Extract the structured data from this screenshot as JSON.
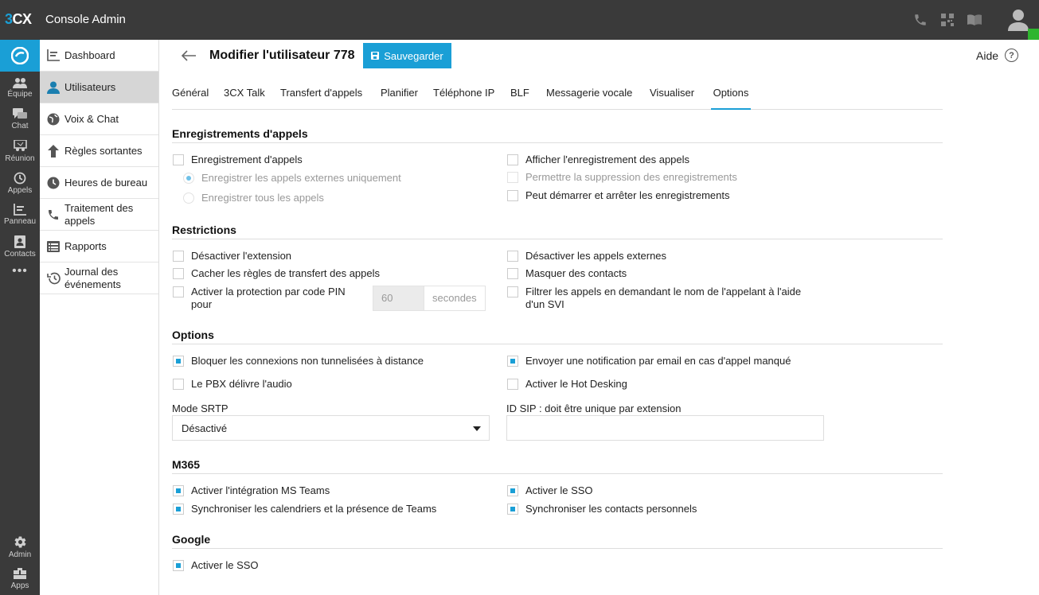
{
  "topbar": {
    "logo_prefix": "3",
    "logo_suffix": "CX",
    "title": "Console Admin",
    "icons": [
      "phone-icon",
      "qr-code-icon",
      "book-icon",
      "user-avatar-icon"
    ],
    "status_color": "#2fb52f"
  },
  "rail": {
    "items": [
      {
        "label": "Équipe",
        "icon": "team-icon"
      },
      {
        "label": "Chat",
        "icon": "chat-icon"
      },
      {
        "label": "Réunion",
        "icon": "meeting-icon"
      },
      {
        "label": "Appels",
        "icon": "call-history-icon"
      },
      {
        "label": "Panneau",
        "icon": "panel-icon"
      },
      {
        "label": "Contacts",
        "icon": "contacts-icon"
      }
    ],
    "more": "•••",
    "bottom": [
      {
        "label": "Admin",
        "icon": "gear-icon"
      },
      {
        "label": "Apps",
        "icon": "apps-icon"
      }
    ]
  },
  "subnav": {
    "items": [
      {
        "label": "Dashboard",
        "icon": "dashboard-icon"
      },
      {
        "label": "Utilisateurs",
        "icon": "user-icon",
        "active": true
      },
      {
        "label": "Voix & Chat",
        "icon": "globe-icon"
      },
      {
        "label": "Règles sortantes",
        "icon": "arrow-up-icon"
      },
      {
        "label": "Heures de bureau",
        "icon": "clock-icon"
      },
      {
        "label": "Traitement des appels",
        "icon": "phone-icon"
      },
      {
        "label": "Rapports",
        "icon": "list-icon"
      },
      {
        "label": "Journal des événements",
        "icon": "history-icon"
      }
    ]
  },
  "header": {
    "title": "Modifier l'utilisateur 778",
    "save_label": "Sauvegarder",
    "help_label": "Aide",
    "help_glyph": "?"
  },
  "tabs": [
    "Général",
    "3CX Talk",
    "Transfert d'appels",
    "Planifier",
    "Téléphone IP",
    "BLF",
    "Messagerie vocale",
    "Visualiser",
    "Options"
  ],
  "active_tab": "Options",
  "recording": {
    "title": "Enregistrements d'appels",
    "record_calls": "Enregistrement d'appels",
    "external_only": "Enregistrer les appels externes uniquement",
    "all_calls": "Enregistrer tous les appels",
    "show_recordings": "Afficher l'enregistrement des appels",
    "allow_delete": "Permettre la suppression des enregistrements",
    "start_stop": "Peut démarrer et arrêter les enregistrements"
  },
  "restrictions": {
    "title": "Restrictions",
    "disable_extension": "Désactiver l'extension",
    "hide_forwarding": "Cacher les règles de transfert des appels",
    "pin_protection": "Activer la protection par code PIN pour",
    "pin_value": "60",
    "pin_unit": "secondes",
    "disable_external": "Désactiver les appels externes",
    "hide_contacts": "Masquer des contacts",
    "filter_ivr": "Filtrer les appels en demandant le nom de l'appelant à l'aide d'un SVI"
  },
  "options": {
    "title": "Options",
    "block_remote": "Bloquer les connexions non tunnelisées à distance",
    "pbx_audio": "Le PBX délivre l'audio",
    "email_missed": "Envoyer une notification par email en cas d'appel manqué",
    "hot_desking": "Activer le Hot Desking",
    "srtp_label": "Mode SRTP",
    "srtp_value": "Désactivé",
    "sip_id_label": "ID SIP : doit être unique par extension",
    "sip_id_value": ""
  },
  "m365": {
    "title": "M365",
    "teams_integration": "Activer l'intégration MS Teams",
    "sync_calendars": "Synchroniser les calendriers et la présence de Teams",
    "enable_sso": "Activer le SSO",
    "sync_contacts": "Synchroniser les contacts personnels"
  },
  "google": {
    "title": "Google",
    "enable_sso": "Activer le SSO"
  },
  "colors": {
    "accent": "#1a9fd6",
    "topbar": "#3a3a3a"
  }
}
